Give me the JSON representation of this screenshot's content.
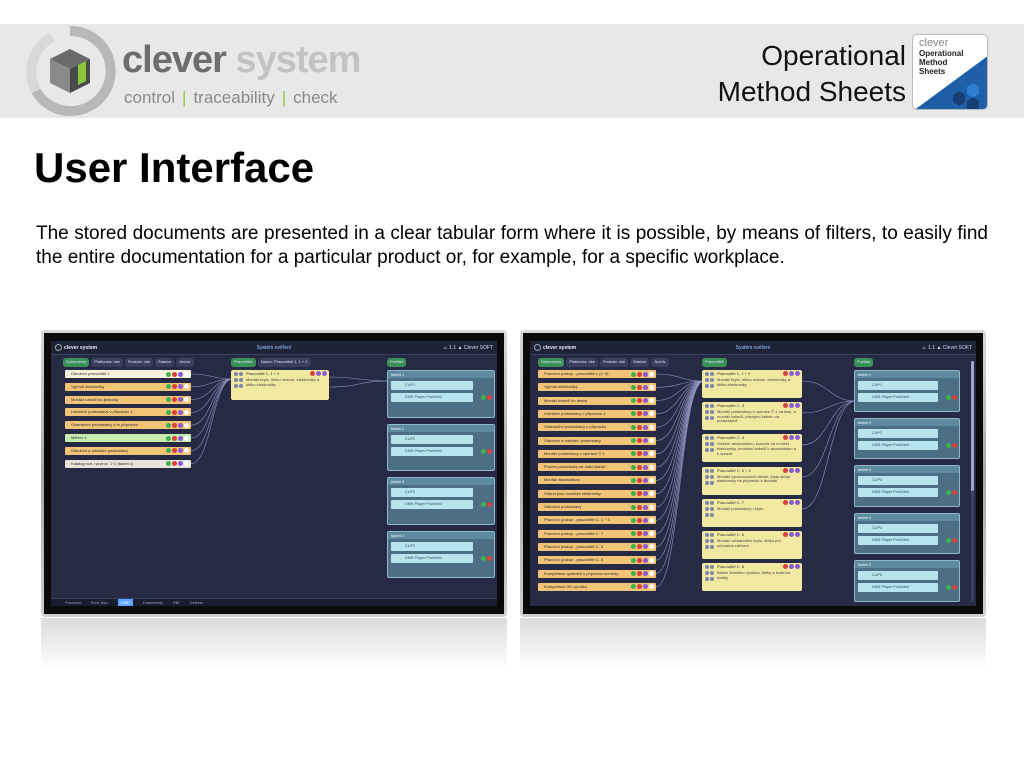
{
  "header": {
    "brand_name_part1": "clever",
    "brand_name_part2": " system",
    "tagline": [
      "control",
      "traceability",
      "check"
    ],
    "title_line1": "Operational",
    "title_line2": "Method Sheets",
    "badge": {
      "line1": "clever",
      "line2": "Operational",
      "line3": "Method",
      "line4": "Sheets"
    }
  },
  "main": {
    "page_title": "User Interface",
    "intro": "The stored documents are presented in a clear tabular form where it is possible, by means of filters, to easily find the entire documentation for a particular product or, for example, for a specific workplace."
  },
  "screenshots": {
    "logo": "clever system",
    "title": "Systém ověření",
    "user": "☺ 1.1   ▲ Clever SOFT",
    "docs_filters": [
      "Dokumenty",
      "Platforma: vše",
      "Produkt: vše",
      "Stanice",
      "Archiv"
    ],
    "ops_filters": [
      "Pracoviště",
      "Název: Pracoviště 1, 1 + 2"
    ],
    "wp_filters": [
      "Počítač"
    ],
    "left_docs": [
      "Obložení pracoviště 1",
      "Vyjmutí elektroniky",
      "Montáž kabelů do jednotky",
      "Umístění podsestavy v přípravku 1",
      "Odstranění podsestavy z lis přípravku",
      "Měření 1",
      "Odložení a odeslání podsestavy",
      "Katalog rozl. na proc. 1÷2 (tablet 1)"
    ],
    "right_docs": [
      "Pracovní postup - pracoviště 1 (1÷3)",
      "Vyjmutí elektroniky",
      "Montáž kabelů do desky",
      "Umístění podsestavy v přípravku 1",
      "Odstranění podsestavy z přípravku",
      "Odložení a odeslání podsestavy",
      "Montáž podsestavy z operace Č.1",
      "Proces podsestavy na další stanici",
      "Montáž akumulátoru",
      "Odkud jsou montáže elektroniky",
      "Odložení podsestavy",
      "Pracovní postup - pracoviště C. 1 ÷ 3",
      "Pracovní postup - pracoviště C. 7",
      "Pracovní postup - pracoviště C. 5",
      "Pracovní postup - pracoviště C. 6",
      "Kompletace opravárů s přípravou kontroly",
      "Kompletace OK výrobku"
    ],
    "left_ops": [
      {
        "title": "Pracoviště 1, 1 + 2",
        "body": "Montáž krytu, štítku motoru, elektroniky a štítku elektroniky"
      }
    ],
    "right_ops": [
      {
        "title": "Pracoviště 1, 1 + 2",
        "body": "Montáž krytu, štítku motoru, elektroniky a štítku elektroniky"
      },
      {
        "title": "Pracoviště C. 3",
        "body": "Montáž podsestavy z operace Č.1 na šasi, a montáž kabelů, připojení kabelu na podsestavě"
      },
      {
        "title": "Pracoviště C. 4",
        "body": "Vložení akumulátoru, konzole na montáž elektroniky, umístění kabelů k akumulátoru a k opravě"
      },
      {
        "title": "Pracoviště C. 5 + 2",
        "body": "Montáž vymezovacích desek, krytu stroje, elektroniky na přípravku k lisování"
      },
      {
        "title": "Pracoviště C. 7",
        "body": "Montáž podsestavy / krytu"
      },
      {
        "title": "Pracoviště C. 6",
        "body": "Montáž ochranného krytu, štítku pro ochranné zařízení"
      },
      {
        "title": "Pracoviště C. 8",
        "body": "Balení finálního výrobku, štítky a kontrola kvality"
      }
    ],
    "left_wps": [
      {
        "title": "tablet 1",
        "boxes": [
          "CUP1",
          "DMS Player Prohlížeč"
        ]
      },
      {
        "title": "tablet 2",
        "boxes": [
          "CUP2",
          "DMS Player Prohlížeč"
        ]
      },
      {
        "title": "tablet 3",
        "boxes": [
          "CUP3",
          "DMS Player Prohlížeč"
        ]
      },
      {
        "title": "tablet 4",
        "boxes": [
          "CUP4",
          "DMS Player Prohlížeč"
        ]
      }
    ],
    "right_wps": [
      {
        "title": "tablet 1",
        "boxes": [
          "CUP1",
          "DMS Player Prohlížeč"
        ]
      },
      {
        "title": "tablet 2",
        "boxes": [
          "CUP2",
          "DMS Player Prohlížeč"
        ]
      },
      {
        "title": "tablet 3",
        "boxes": [
          "CUP3",
          "DMS Player Prohlížeč"
        ]
      },
      {
        "title": "tablet 4",
        "boxes": [
          "CUP4",
          "DMS Player Prohlížeč"
        ]
      },
      {
        "title": "tablet 5",
        "boxes": [
          "CUP5",
          "DMS Player Prohlížeč"
        ]
      }
    ],
    "bottom_bar": [
      "Procesní",
      "Font: Aku",
      "CMD",
      "Dokumenty",
      "Filtr",
      "Celkem"
    ]
  },
  "colors": {
    "accent_green": "#8dc63f",
    "screen_bg": "#262a44",
    "doc_orange": "#f2c477",
    "op_yellow": "#f1e9a1",
    "wp_blue": "#4c6f86"
  }
}
